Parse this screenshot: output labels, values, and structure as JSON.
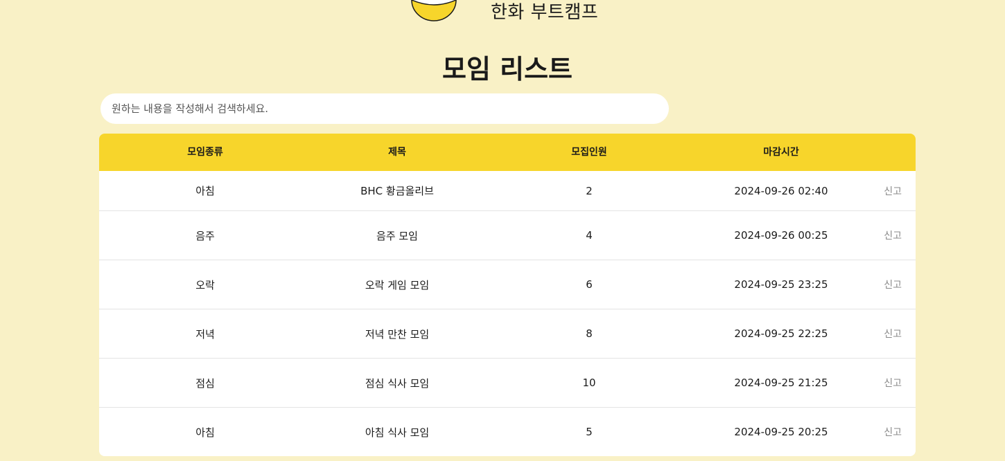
{
  "header": {
    "brand": "한화 부트캠프",
    "logo_icon": "yellow-bowl-logo"
  },
  "page_title": "모임 리스트",
  "search": {
    "placeholder": "원하는 내용을 작성해서 검색하세요.",
    "value": ""
  },
  "table": {
    "columns": [
      "모임종류",
      "제목",
      "모집인원",
      "마감시간"
    ],
    "report_label": "신고",
    "rows": [
      {
        "type": "아침",
        "title": "BHC 황금올리브",
        "count": "2",
        "deadline": "2024-09-26 02:40"
      },
      {
        "type": "음주",
        "title": "음주 모임",
        "count": "4",
        "deadline": "2024-09-26 00:25"
      },
      {
        "type": "오락",
        "title": "오락 게임 모임",
        "count": "6",
        "deadline": "2024-09-25 23:25"
      },
      {
        "type": "저녁",
        "title": "저녁 만찬 모임",
        "count": "8",
        "deadline": "2024-09-25 22:25"
      },
      {
        "type": "점심",
        "title": "점심 식사 모임",
        "count": "10",
        "deadline": "2024-09-25 21:25"
      },
      {
        "type": "아침",
        "title": "아침 식사 모임",
        "count": "5",
        "deadline": "2024-09-25 20:25"
      }
    ]
  },
  "colors": {
    "background": "#f9f1c6",
    "accent": "#f7d52b",
    "surface": "#ffffff",
    "muted_text": "#8a8a8a"
  }
}
